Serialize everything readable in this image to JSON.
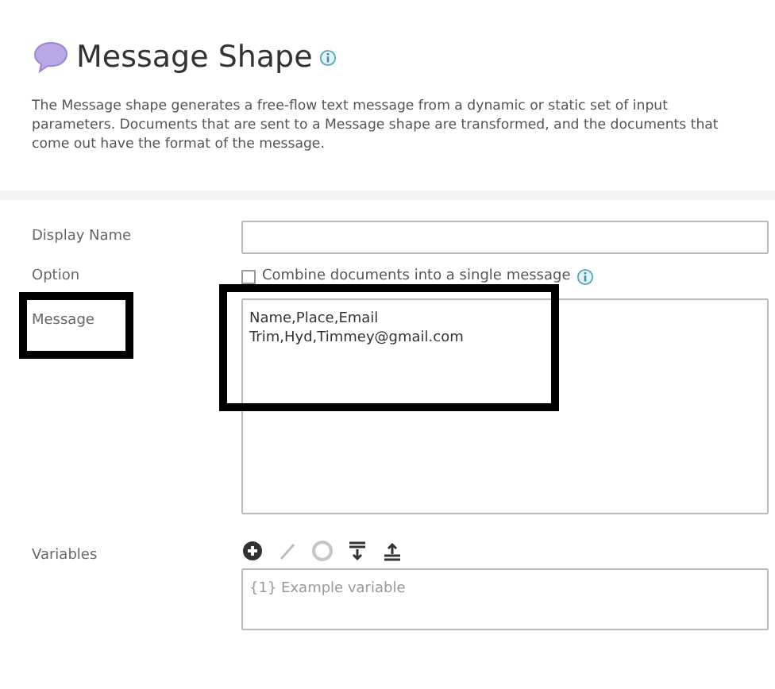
{
  "header": {
    "title": "Message Shape",
    "description": "The Message shape generates a free-flow text message from a dynamic or static set of input parameters. Documents that are sent to a Message shape are transformed, and the documents that come out have the format of the message."
  },
  "form": {
    "display_name": {
      "label": "Display Name"
    },
    "option": {
      "label": "Option",
      "checkbox_label": "Combine documents into a single message",
      "checked": false
    },
    "message": {
      "label": "Message",
      "value": "Name,Place,Email\nTrim,Hyd,Timmey@gmail.com",
      "highlighted": true
    },
    "variables": {
      "label": "Variables",
      "placeholder": "{1} Example variable",
      "toolbar": [
        {
          "kind": "add",
          "disabled": false
        },
        {
          "kind": "edit",
          "disabled": true
        },
        {
          "kind": "remove",
          "disabled": true
        },
        {
          "kind": "move-down",
          "disabled": false
        },
        {
          "kind": "move-up",
          "disabled": false
        }
      ]
    }
  }
}
